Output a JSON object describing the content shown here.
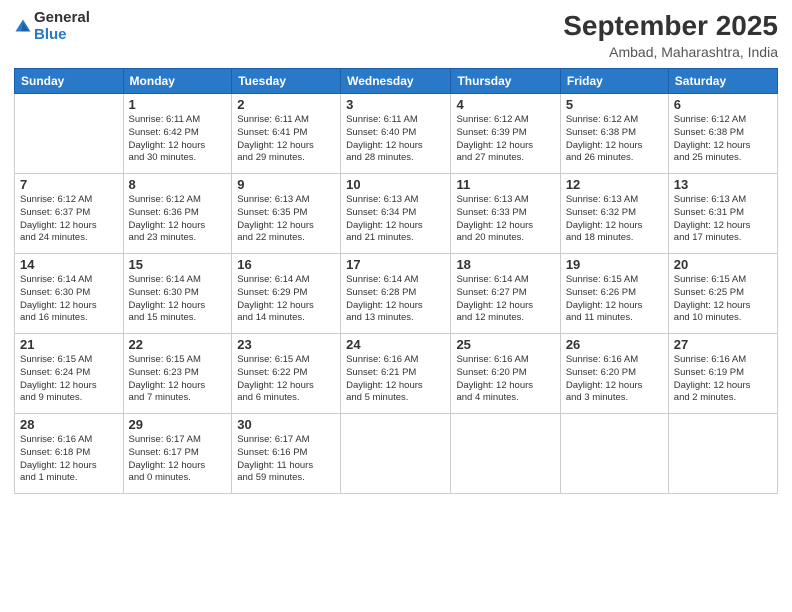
{
  "logo": {
    "general": "General",
    "blue": "Blue"
  },
  "title": {
    "month": "September 2025",
    "location": "Ambad, Maharashtra, India"
  },
  "weekdays": [
    "Sunday",
    "Monday",
    "Tuesday",
    "Wednesday",
    "Thursday",
    "Friday",
    "Saturday"
  ],
  "weeks": [
    [
      {
        "day": "",
        "info": ""
      },
      {
        "day": "1",
        "info": "Sunrise: 6:11 AM\nSunset: 6:42 PM\nDaylight: 12 hours\nand 30 minutes."
      },
      {
        "day": "2",
        "info": "Sunrise: 6:11 AM\nSunset: 6:41 PM\nDaylight: 12 hours\nand 29 minutes."
      },
      {
        "day": "3",
        "info": "Sunrise: 6:11 AM\nSunset: 6:40 PM\nDaylight: 12 hours\nand 28 minutes."
      },
      {
        "day": "4",
        "info": "Sunrise: 6:12 AM\nSunset: 6:39 PM\nDaylight: 12 hours\nand 27 minutes."
      },
      {
        "day": "5",
        "info": "Sunrise: 6:12 AM\nSunset: 6:38 PM\nDaylight: 12 hours\nand 26 minutes."
      },
      {
        "day": "6",
        "info": "Sunrise: 6:12 AM\nSunset: 6:38 PM\nDaylight: 12 hours\nand 25 minutes."
      }
    ],
    [
      {
        "day": "7",
        "info": "Sunrise: 6:12 AM\nSunset: 6:37 PM\nDaylight: 12 hours\nand 24 minutes."
      },
      {
        "day": "8",
        "info": "Sunrise: 6:12 AM\nSunset: 6:36 PM\nDaylight: 12 hours\nand 23 minutes."
      },
      {
        "day": "9",
        "info": "Sunrise: 6:13 AM\nSunset: 6:35 PM\nDaylight: 12 hours\nand 22 minutes."
      },
      {
        "day": "10",
        "info": "Sunrise: 6:13 AM\nSunset: 6:34 PM\nDaylight: 12 hours\nand 21 minutes."
      },
      {
        "day": "11",
        "info": "Sunrise: 6:13 AM\nSunset: 6:33 PM\nDaylight: 12 hours\nand 20 minutes."
      },
      {
        "day": "12",
        "info": "Sunrise: 6:13 AM\nSunset: 6:32 PM\nDaylight: 12 hours\nand 18 minutes."
      },
      {
        "day": "13",
        "info": "Sunrise: 6:13 AM\nSunset: 6:31 PM\nDaylight: 12 hours\nand 17 minutes."
      }
    ],
    [
      {
        "day": "14",
        "info": "Sunrise: 6:14 AM\nSunset: 6:30 PM\nDaylight: 12 hours\nand 16 minutes."
      },
      {
        "day": "15",
        "info": "Sunrise: 6:14 AM\nSunset: 6:30 PM\nDaylight: 12 hours\nand 15 minutes."
      },
      {
        "day": "16",
        "info": "Sunrise: 6:14 AM\nSunset: 6:29 PM\nDaylight: 12 hours\nand 14 minutes."
      },
      {
        "day": "17",
        "info": "Sunrise: 6:14 AM\nSunset: 6:28 PM\nDaylight: 12 hours\nand 13 minutes."
      },
      {
        "day": "18",
        "info": "Sunrise: 6:14 AM\nSunset: 6:27 PM\nDaylight: 12 hours\nand 12 minutes."
      },
      {
        "day": "19",
        "info": "Sunrise: 6:15 AM\nSunset: 6:26 PM\nDaylight: 12 hours\nand 11 minutes."
      },
      {
        "day": "20",
        "info": "Sunrise: 6:15 AM\nSunset: 6:25 PM\nDaylight: 12 hours\nand 10 minutes."
      }
    ],
    [
      {
        "day": "21",
        "info": "Sunrise: 6:15 AM\nSunset: 6:24 PM\nDaylight: 12 hours\nand 9 minutes."
      },
      {
        "day": "22",
        "info": "Sunrise: 6:15 AM\nSunset: 6:23 PM\nDaylight: 12 hours\nand 7 minutes."
      },
      {
        "day": "23",
        "info": "Sunrise: 6:15 AM\nSunset: 6:22 PM\nDaylight: 12 hours\nand 6 minutes."
      },
      {
        "day": "24",
        "info": "Sunrise: 6:16 AM\nSunset: 6:21 PM\nDaylight: 12 hours\nand 5 minutes."
      },
      {
        "day": "25",
        "info": "Sunrise: 6:16 AM\nSunset: 6:20 PM\nDaylight: 12 hours\nand 4 minutes."
      },
      {
        "day": "26",
        "info": "Sunrise: 6:16 AM\nSunset: 6:20 PM\nDaylight: 12 hours\nand 3 minutes."
      },
      {
        "day": "27",
        "info": "Sunrise: 6:16 AM\nSunset: 6:19 PM\nDaylight: 12 hours\nand 2 minutes."
      }
    ],
    [
      {
        "day": "28",
        "info": "Sunrise: 6:16 AM\nSunset: 6:18 PM\nDaylight: 12 hours\nand 1 minute."
      },
      {
        "day": "29",
        "info": "Sunrise: 6:17 AM\nSunset: 6:17 PM\nDaylight: 12 hours\nand 0 minutes."
      },
      {
        "day": "30",
        "info": "Sunrise: 6:17 AM\nSunset: 6:16 PM\nDaylight: 11 hours\nand 59 minutes."
      },
      {
        "day": "",
        "info": ""
      },
      {
        "day": "",
        "info": ""
      },
      {
        "day": "",
        "info": ""
      },
      {
        "day": "",
        "info": ""
      }
    ]
  ]
}
